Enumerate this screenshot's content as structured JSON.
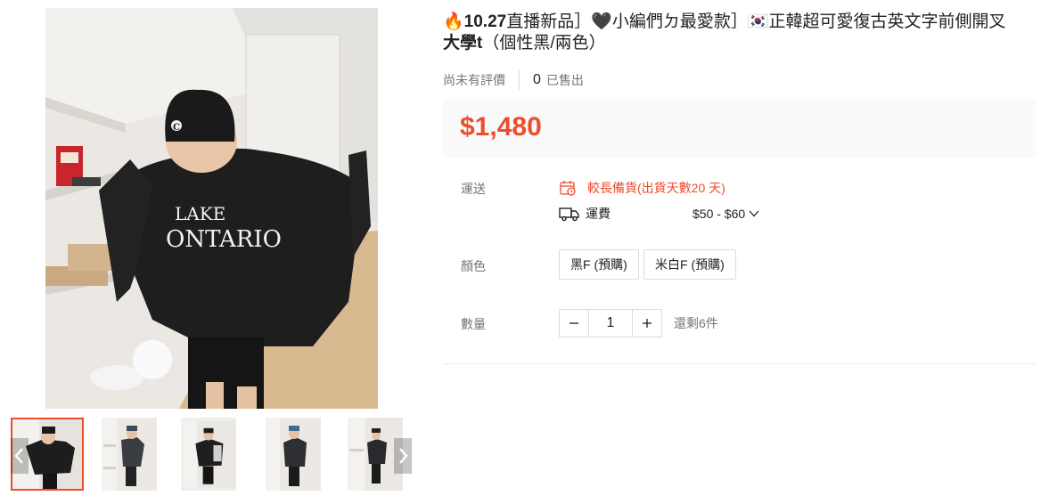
{
  "gallery": {
    "main_image_icon": "product-photo",
    "prev_icon": "chevron-left-icon",
    "next_icon": "chevron-right-icon",
    "active_thumbnail": 0,
    "thumbnail_count": 5
  },
  "product": {
    "title_flame": "🔥",
    "title_date": "10.27",
    "title_rest": "直播新品］🖤小編們ㄉ最愛款］🇰🇷正韓超可愛復古英文字前側開叉",
    "title_line2_bold": "大學t",
    "title_line2_rest": "（個性黑/兩色）",
    "rating_text": "尚未有評價",
    "sold_count": "0",
    "sold_label": "已售出",
    "price": "$1,480"
  },
  "shipping": {
    "label": "運送",
    "warning": "較長備貨(出貨天數20 天)",
    "fee_label": "運費",
    "fee_range": "$50 - $60",
    "calendar_icon": "calendar-icon",
    "truck_icon": "truck-icon",
    "dropdown_icon": "chevron-down-icon"
  },
  "color": {
    "label": "顏色",
    "options": [
      "黑F (預購)",
      "米白F (預購)"
    ]
  },
  "quantity": {
    "label": "數量",
    "value": "1",
    "stock": "還剩6件",
    "minus_icon": "minus-icon",
    "plus_icon": "plus-icon"
  },
  "colors": {
    "accent": "#ee4d2d",
    "price_bg": "#fafafa",
    "muted": "#757575",
    "border": "#dcdcdc"
  }
}
